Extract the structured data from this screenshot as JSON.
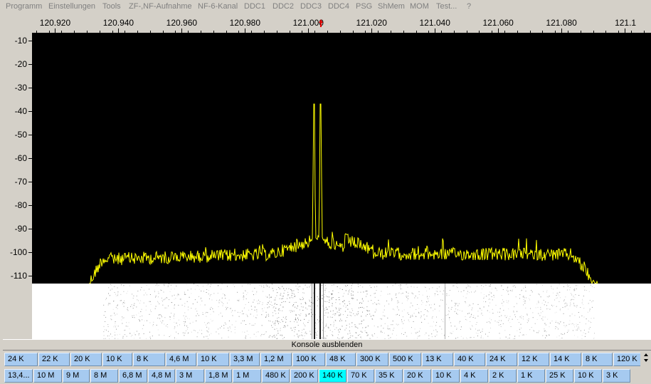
{
  "menu": [
    "Programm",
    "Einstellungen",
    "Tools",
    "ZF-,NF-Aufnahme",
    "NF-6-Kanal",
    "DDC1",
    "DDC2",
    "DDC3",
    "DDC4",
    "PSG",
    "ShMem",
    "MOM",
    "Test...",
    "?"
  ],
  "frequency_scale": {
    "labels": [
      "120.920",
      "120.940",
      "120.960",
      "120.980",
      "121.000",
      "121.020",
      "121.040",
      "121.060",
      "121.080",
      "121.1"
    ],
    "marker_frequency": 121.004
  },
  "level_scale": {
    "labels": [
      "-10",
      "-20",
      "-30",
      "-40",
      "-50",
      "-60",
      "-70",
      "-80",
      "-90",
      "-100",
      "-110"
    ]
  },
  "console_toggle": {
    "label": "Konsole ausblenden"
  },
  "bandwidth_row_1": [
    "24 K",
    "22 K",
    "20 K",
    "10 K",
    "8 K",
    "4,6 M",
    "10 K",
    "3,3 M",
    "1,2 M",
    "100 K",
    "48 K",
    "300 K",
    "500 K",
    "13 K",
    "40 K",
    "24 K",
    "12 K",
    "14 K",
    "8 K",
    "120 K"
  ],
  "bandwidth_row_2": [
    "13,4...",
    "10 M",
    "9 M",
    "8 M",
    "6,8 M",
    "4,8 M",
    "3 M",
    "1,8 M",
    "1 M",
    "480 K",
    "200 K",
    "140 K",
    "70 K",
    "35 K",
    "20 K",
    "10 K",
    "4 K",
    "2 K",
    "1 K",
    "25 K",
    "10 K",
    "3 K"
  ],
  "bandwidth_row_2_selected": "140 K",
  "colors": {
    "spectrum_trace": "#ffff00",
    "spectrum_background": "#000000",
    "selected_button": "#00ffff",
    "button": "#a6caf0",
    "marker": "#e00000"
  },
  "icons": [
    "spin-up-icon",
    "spin-down-icon",
    "frequency-marker-icon"
  ]
}
